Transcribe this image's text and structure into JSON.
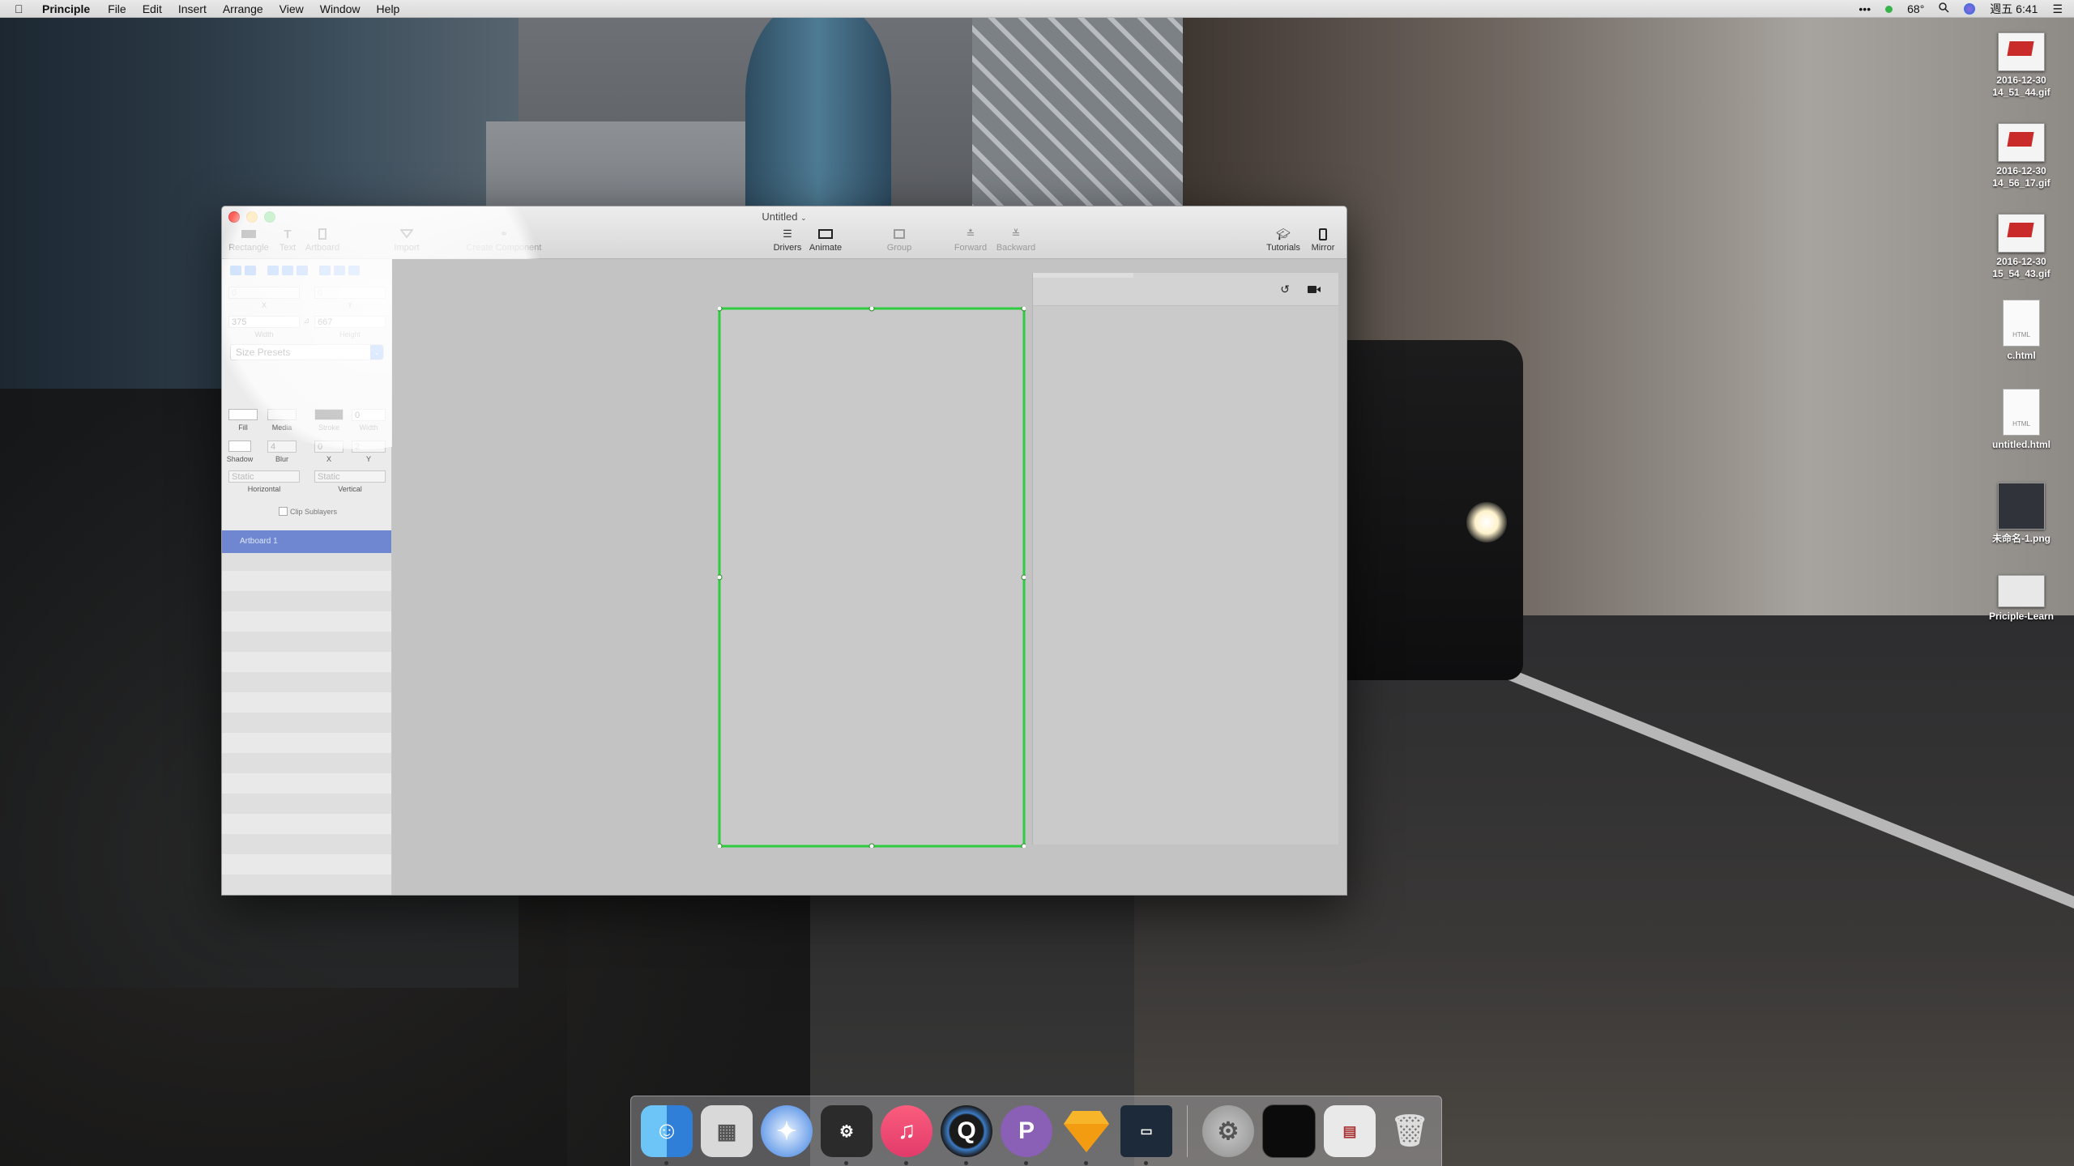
{
  "menubar": {
    "app_name": "Principle",
    "menus": [
      "File",
      "Edit",
      "Insert",
      "Arrange",
      "View",
      "Window",
      "Help"
    ],
    "temperature": "68°",
    "clock": "週五 6:41"
  },
  "desktop_icons": [
    {
      "label": "2016-12-30\n14_51_44.gif"
    },
    {
      "label": "2016-12-30\n14_56_17.gif"
    },
    {
      "label": "2016-12-30\n15_54_43.gif"
    },
    {
      "label": "c.html"
    },
    {
      "label": "untitled.html"
    },
    {
      "label": "未命名-1.png"
    },
    {
      "label": "Priciple-Learn"
    }
  ],
  "window": {
    "title": "Untitled",
    "toolbar": {
      "rectangle": "Rectangle",
      "text": "Text",
      "artboard": "Artboard",
      "import": "Import",
      "create_component": "Create Component",
      "drivers": "Drivers",
      "animate": "Animate",
      "group": "Group",
      "forward": "Forward",
      "backward": "Backward",
      "tutorials": "Tutorials",
      "mirror": "Mirror"
    },
    "inspector": {
      "x_value": "0",
      "y_value": "0",
      "x_label": "X",
      "y_label": "Y",
      "width_value": "375",
      "height_value": "667",
      "width_label": "Width",
      "height_label": "Height",
      "size_presets": "Size Presets",
      "fill_label": "Fill",
      "media_label": "Media",
      "stroke_label": "Stroke",
      "stroke_width_value": "0",
      "stroke_width_label": "Width",
      "shadow_label": "Shadow",
      "blur_label": "Blur",
      "blur_value": "4",
      "shadow_x_label": "X",
      "shadow_x_value": "0",
      "shadow_y_label": "Y",
      "shadow_y_value": "2",
      "horizontal_value": "Static",
      "horizontal_label": "Horizontal",
      "vertical_value": "Static",
      "vertical_label": "Vertical",
      "clip_sublayers": "Clip Sublayers"
    },
    "layers": {
      "selected": "Artboard 1"
    },
    "colors": {
      "selection_outline": "#2ecc40",
      "layer_selected": "#6e87d0",
      "accent": "#2d7cf6"
    }
  }
}
